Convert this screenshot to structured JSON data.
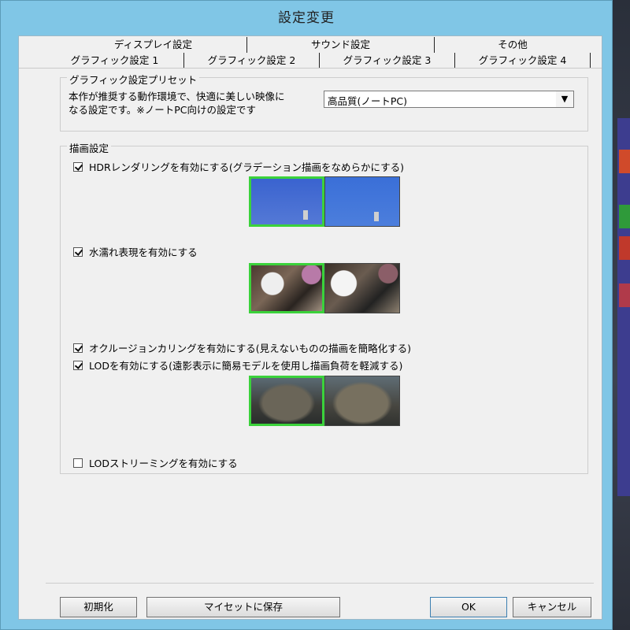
{
  "window": {
    "title": "設定変更"
  },
  "tabs": {
    "row1": [
      "ディスプレイ設定",
      "サウンド設定",
      "その他"
    ],
    "row2": [
      "グラフィック設定 1",
      "グラフィック設定 2",
      "グラフィック設定 3",
      "グラフィック設定 4"
    ],
    "active": "グラフィック設定 1"
  },
  "preset": {
    "legend": "グラフィック設定プリセット",
    "description_line1": "本作が推奨する動作環境で、快適に美しい映像に",
    "description_line2": "なる設定です。※ノートPC向けの設定です",
    "selected": "高品質(ノートPC)"
  },
  "render": {
    "legend": "描画設定",
    "options": [
      {
        "label": "HDRレンダリングを有効にする(グラデーション描画をなめらかにする)",
        "checked": true
      },
      {
        "label": "水濡れ表現を有効にする",
        "checked": true
      },
      {
        "label": "オクルージョンカリングを有効にする(見えないものの描画を簡略化する)",
        "checked": true
      },
      {
        "label": "LODを有効にする(遠影表示に簡易モデルを使用し描画負荷を軽減する)",
        "checked": true
      },
      {
        "label": "LODストリーミングを有効にする",
        "checked": false
      }
    ]
  },
  "buttons": {
    "reset": "初期化",
    "save_preset": "マイセットに保存",
    "ok": "OK",
    "cancel": "キャンセル"
  },
  "colors": {
    "titlebar": "#80c6e6",
    "dialog_bg": "#f0f0f0",
    "preview_selected_border": "#3bd23b"
  }
}
